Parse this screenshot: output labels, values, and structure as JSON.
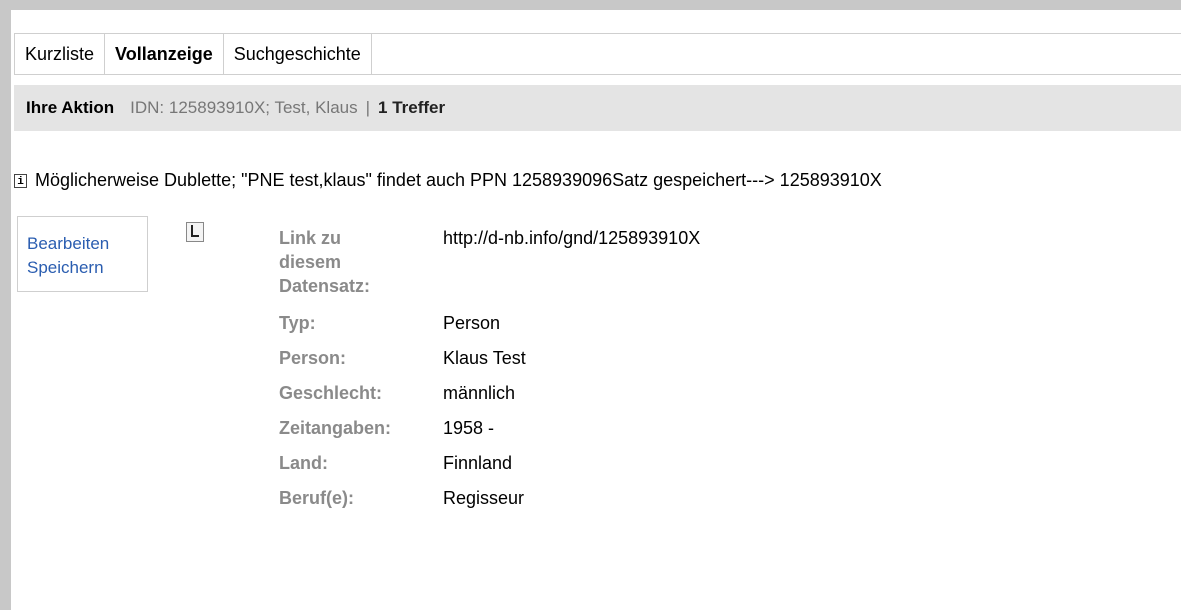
{
  "tabs": [
    {
      "label": "Kurzliste",
      "active": false
    },
    {
      "label": "Vollanzeige",
      "active": true
    },
    {
      "label": "Suchgeschichte",
      "active": false
    }
  ],
  "action_bar": {
    "label": "Ihre Aktion",
    "idn_text": "IDN: 125893910X; Test, Klaus",
    "separator": "|",
    "hits": "1 Treffer"
  },
  "info": {
    "icon": "info-icon",
    "icon_glyph": "i",
    "message": "Möglicherweise Dublette; \"PNE test,klaus\" findet auch PPN 1258939096Satz gespeichert---> 125893910X"
  },
  "edit_box": {
    "edit_label": "Bearbeiten",
    "save_label": "Speichern"
  },
  "record": {
    "link_label_line1": "Link zu",
    "link_label_line2": "diesem",
    "link_label_line3": "Datensatz:",
    "link_value": "http://d-nb.info/gnd/125893910X",
    "fields": [
      {
        "label": "Typ:",
        "value": "Person"
      },
      {
        "label": "Person:",
        "value": "Klaus Test"
      },
      {
        "label": "Geschlecht:",
        "value": "männlich"
      },
      {
        "label": "Zeitangaben:",
        "value": "1958 -"
      },
      {
        "label": "Land:",
        "value": "Finnland"
      },
      {
        "label": "Beruf(e):",
        "value": "Regisseur"
      }
    ]
  },
  "colors": {
    "link": "#2a5db0",
    "label_gray": "#8a8a8a",
    "bar_gray": "#e4e4e4"
  }
}
